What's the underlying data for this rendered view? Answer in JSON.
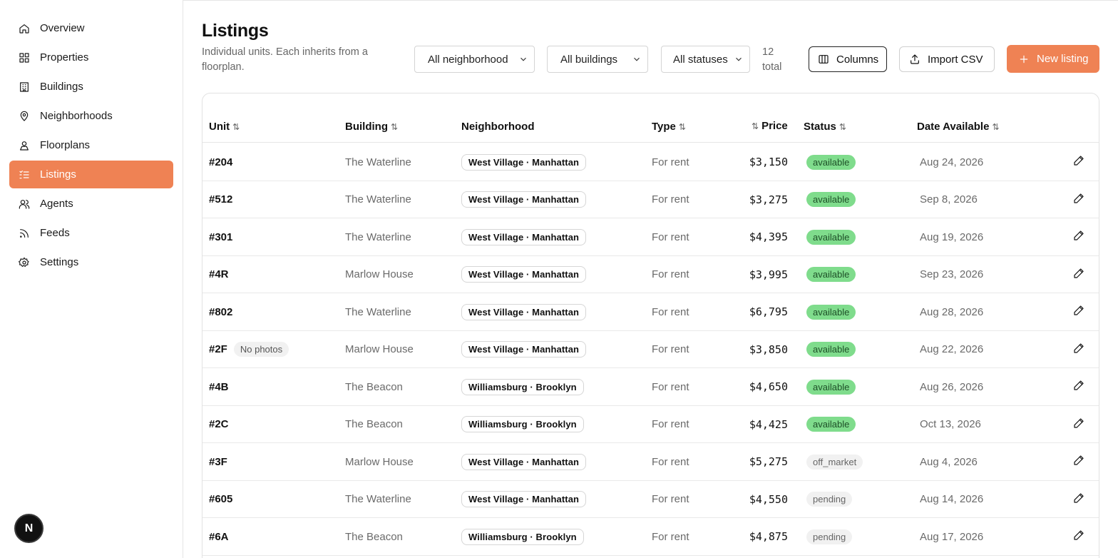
{
  "sidebar": {
    "items": [
      {
        "label": "Overview",
        "icon": "home-icon"
      },
      {
        "label": "Properties",
        "icon": "grid-icon"
      },
      {
        "label": "Buildings",
        "icon": "building-icon"
      },
      {
        "label": "Neighborhoods",
        "icon": "map-pin-icon"
      },
      {
        "label": "Floorplans",
        "icon": "floorplan-icon"
      },
      {
        "label": "Listings",
        "icon": "list-icon",
        "active": true
      },
      {
        "label": "Agents",
        "icon": "users-icon"
      },
      {
        "label": "Feeds",
        "icon": "rss-icon"
      },
      {
        "label": "Settings",
        "icon": "gear-icon"
      }
    ],
    "fab_label": "N"
  },
  "header": {
    "title": "Listings",
    "subtitle": "Individual units. Each inherits from a floorplan.",
    "filters": {
      "neighborhood": "All neighborhood",
      "buildings": "All buildings",
      "statuses": "All statuses"
    },
    "total": "12 total",
    "columns_label": "Columns",
    "import_label": "Import CSV",
    "new_label": "New listing"
  },
  "table": {
    "columns": {
      "unit": "Unit",
      "building": "Building",
      "neighborhood": "Neighborhood",
      "type": "Type",
      "price": "Price",
      "status": "Status",
      "date": "Date Available"
    },
    "sort_glyph": "⇅",
    "rows": [
      {
        "unit": "#204",
        "building": "The Waterline",
        "neighborhood": "West Village · Manhattan",
        "type": "For rent",
        "price": "$3,150",
        "status": "available",
        "date": "Aug 24, 2026"
      },
      {
        "unit": "#512",
        "building": "The Waterline",
        "neighborhood": "West Village · Manhattan",
        "type": "For rent",
        "price": "$3,275",
        "status": "available",
        "date": "Sep 8, 2026"
      },
      {
        "unit": "#301",
        "building": "The Waterline",
        "neighborhood": "West Village · Manhattan",
        "type": "For rent",
        "price": "$4,395",
        "status": "available",
        "date": "Aug 19, 2026"
      },
      {
        "unit": "#4R",
        "building": "Marlow House",
        "neighborhood": "West Village · Manhattan",
        "type": "For rent",
        "price": "$3,995",
        "status": "available",
        "date": "Sep 23, 2026"
      },
      {
        "unit": "#802",
        "building": "The Waterline",
        "neighborhood": "West Village · Manhattan",
        "type": "For rent",
        "price": "$6,795",
        "status": "available",
        "date": "Aug 28, 2026"
      },
      {
        "unit": "#2F",
        "tag": "No photos",
        "building": "Marlow House",
        "neighborhood": "West Village · Manhattan",
        "type": "For rent",
        "price": "$3,850",
        "status": "available",
        "date": "Aug 22, 2026"
      },
      {
        "unit": "#4B",
        "building": "The Beacon",
        "neighborhood": "Williamsburg · Brooklyn",
        "type": "For rent",
        "price": "$4,650",
        "status": "available",
        "date": "Aug 26, 2026"
      },
      {
        "unit": "#2C",
        "building": "The Beacon",
        "neighborhood": "Williamsburg · Brooklyn",
        "type": "For rent",
        "price": "$4,425",
        "status": "available",
        "date": "Oct 13, 2026"
      },
      {
        "unit": "#3F",
        "building": "Marlow House",
        "neighborhood": "West Village · Manhattan",
        "type": "For rent",
        "price": "$5,275",
        "status": "off_market",
        "date": "Aug 4, 2026"
      },
      {
        "unit": "#605",
        "building": "The Waterline",
        "neighborhood": "West Village · Manhattan",
        "type": "For rent",
        "price": "$4,550",
        "status": "pending",
        "date": "Aug 14, 2026"
      },
      {
        "unit": "#6A",
        "building": "The Beacon",
        "neighborhood": "Williamsburg · Brooklyn",
        "type": "For rent",
        "price": "$4,875",
        "status": "pending",
        "date": "Aug 17, 2026"
      }
    ]
  },
  "colors": {
    "accent": "#ef8254",
    "available_bg": "#7fdc8c",
    "muted_bg": "#f1f1f1"
  }
}
